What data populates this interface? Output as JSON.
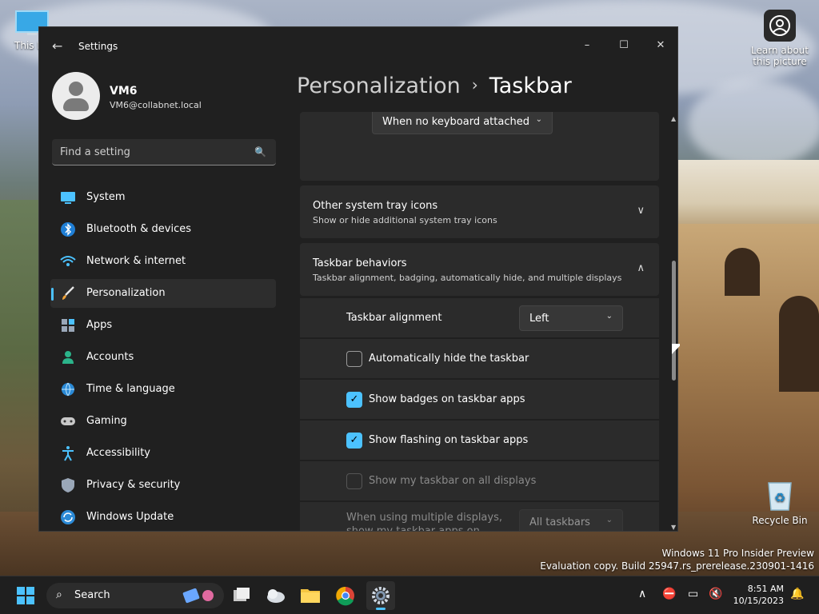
{
  "desktop": {
    "icons": [
      {
        "id": "this-pc",
        "label": "This PC"
      },
      {
        "id": "learn-picture",
        "label": "Learn about this picture"
      },
      {
        "id": "recycle-bin",
        "label": "Recycle Bin"
      }
    ],
    "watermark": {
      "line1": "Windows 11 Pro Insider Preview",
      "line2": "Evaluation copy. Build 25947.rs_prerelease.230901-1416"
    }
  },
  "window": {
    "title": "Settings",
    "controls": {
      "minimize": "–",
      "maximize": "☐",
      "close": "✕"
    }
  },
  "profile": {
    "name": "VM6",
    "email": "VM6@collabnet.local"
  },
  "search": {
    "placeholder": "Find a setting"
  },
  "nav": {
    "items": [
      {
        "label": "System",
        "icon": "monitor-icon",
        "color": "#4cc2ff"
      },
      {
        "label": "Bluetooth & devices",
        "icon": "bluetooth-icon",
        "color": "#4cc2ff"
      },
      {
        "label": "Network & internet",
        "icon": "wifi-icon",
        "color": "#4cc2ff"
      },
      {
        "label": "Personalization",
        "icon": "brush-icon",
        "color": "#f0a33a",
        "active": true
      },
      {
        "label": "Apps",
        "icon": "apps-icon",
        "color": "#9aa7b8"
      },
      {
        "label": "Accounts",
        "icon": "person-icon",
        "color": "#2bb48a"
      },
      {
        "label": "Time & language",
        "icon": "globe-icon",
        "color": "#4cc2ff"
      },
      {
        "label": "Gaming",
        "icon": "controller-icon",
        "color": "#c8c8c8"
      },
      {
        "label": "Accessibility",
        "icon": "accessibility-icon",
        "color": "#4cc2ff"
      },
      {
        "label": "Privacy & security",
        "icon": "shield-icon",
        "color": "#9aa7b8"
      },
      {
        "label": "Windows Update",
        "icon": "update-icon",
        "color": "#4cc2ff"
      }
    ]
  },
  "breadcrumb": {
    "parent": "Personalization",
    "separator": "›",
    "current": "Taskbar"
  },
  "content": {
    "keyboard_dropdown": "When no keyboard attached",
    "tray_icons": {
      "title": "Other system tray icons",
      "subtitle": "Show or hide additional system tray icons"
    },
    "behaviors": {
      "title": "Taskbar behaviors",
      "subtitle": "Taskbar alignment, badging, automatically hide, and multiple displays",
      "alignment_label": "Taskbar alignment",
      "alignment_value": "Left",
      "options": [
        {
          "label": "Automatically hide the taskbar",
          "checked": false,
          "disabled": false
        },
        {
          "label": "Show badges on taskbar apps",
          "checked": true,
          "disabled": false
        },
        {
          "label": "Show flashing on taskbar apps",
          "checked": true,
          "disabled": false
        },
        {
          "label": "Show my taskbar on all displays",
          "checked": false,
          "disabled": true
        }
      ],
      "multi_display_label": "When using multiple displays, show my taskbar apps on",
      "multi_display_value": "All taskbars"
    }
  },
  "taskbar": {
    "search_label": "Search",
    "time": "8:51 AM",
    "date": "10/15/2023"
  },
  "colors": {
    "accent": "#4cc2ff",
    "window_bg": "#202020",
    "card_bg": "#2b2b2b"
  }
}
